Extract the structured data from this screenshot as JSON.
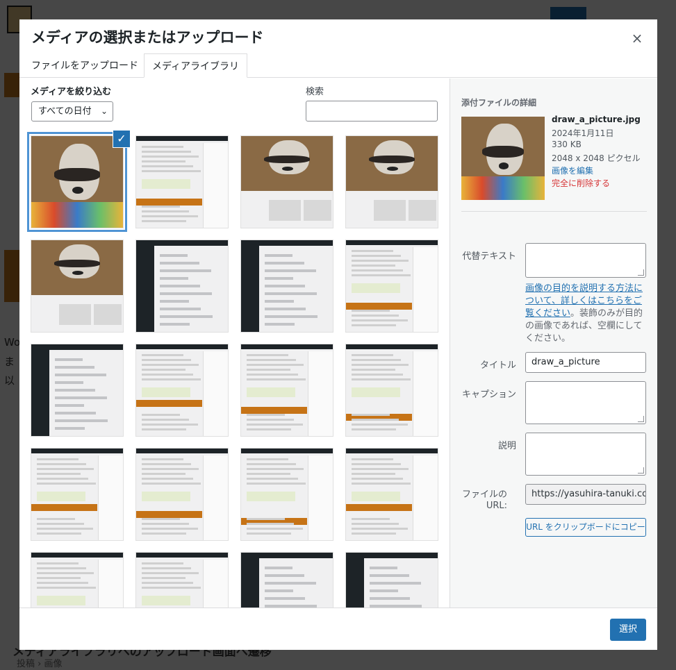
{
  "background": {
    "heading": "メディアライブラリへのアップロード画面へ遷移",
    "breadcrumb": [
      "投稿",
      "画像"
    ],
    "text_fragments": [
      "Wo",
      "ま",
      "以"
    ]
  },
  "modal": {
    "title": "メディアの選択またはアップロード",
    "close_icon": "×",
    "tabs": [
      {
        "label": "ファイルをアップロード",
        "active": false
      },
      {
        "label": "メディアライブラリ",
        "active": true
      }
    ],
    "filter_label": "メディアを絞り込む",
    "date_filter": "すべての日付",
    "search_label": "検索",
    "search_value": "",
    "grid_items": [
      {
        "kind": "raccoon",
        "selected": true
      },
      {
        "kind": "article-light"
      },
      {
        "kind": "raccoon-coffee"
      },
      {
        "kind": "raccoon-coffee"
      },
      {
        "kind": "raccoon-page"
      },
      {
        "kind": "admin-dark"
      },
      {
        "kind": "admin-dark"
      },
      {
        "kind": "article-light"
      },
      {
        "kind": "admin-dark"
      },
      {
        "kind": "article-light"
      },
      {
        "kind": "article-light"
      },
      {
        "kind": "article-light"
      },
      {
        "kind": "article-light"
      },
      {
        "kind": "article-light"
      },
      {
        "kind": "article-light"
      },
      {
        "kind": "article-light"
      },
      {
        "kind": "article-light"
      },
      {
        "kind": "article-light"
      },
      {
        "kind": "admin-dark"
      },
      {
        "kind": "admin-dark"
      }
    ],
    "check_icon": "✓"
  },
  "details": {
    "title": "添付ファイルの詳細",
    "filename": "draw_a_picture.jpg",
    "date": "2024年1月11日",
    "size": "330 KB",
    "dimensions": "2048 x 2048 ピクセル",
    "edit_link": "画像を編集",
    "delete_link": "完全に削除する",
    "alt_label": "代替テキスト",
    "alt_value": "",
    "help_link": "画像の目的を説明する方法について、詳しくはこちらをご覧ください",
    "help_text": "。装飾のみが目的の画像であれば、空欄にしてください。",
    "title_label": "タイトル",
    "title_value": "draw_a_picture",
    "caption_label": "キャプション",
    "caption_value": "",
    "desc_label": "説明",
    "desc_value": "",
    "url_label": "ファイルの URL:",
    "url_value": "https://yasuhira-tanuki.com",
    "copy_button": "URL をクリップボードにコピー"
  },
  "footer": {
    "select_button": "選択"
  },
  "colors": {
    "primary": "#2271b1",
    "danger": "#d63638",
    "accent_orange": "#c97a1e"
  }
}
